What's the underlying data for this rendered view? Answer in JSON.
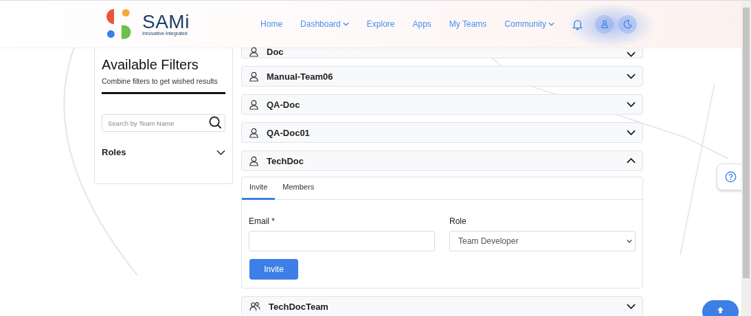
{
  "logo": {
    "name": "SAMi",
    "tagline": "Innovative-Integrated"
  },
  "nav": [
    {
      "label": "Home",
      "dropdown": false
    },
    {
      "label": "Dashboard",
      "dropdown": true
    },
    {
      "label": "Explore",
      "dropdown": false
    },
    {
      "label": "Apps",
      "dropdown": false
    },
    {
      "label": "My Teams",
      "dropdown": false
    },
    {
      "label": "Community",
      "dropdown": true
    }
  ],
  "filters": {
    "title": "Available Filters",
    "subtitle": "Combine filters to get wished results",
    "search": {
      "placeholder": "Search by Team Name"
    },
    "sections": [
      {
        "label": "Roles",
        "expanded": false
      }
    ]
  },
  "teams": [
    {
      "name": "Doc",
      "kind": "single",
      "expanded": false
    },
    {
      "name": "Manual-Team06",
      "kind": "single",
      "expanded": false
    },
    {
      "name": "QA-Doc",
      "kind": "single",
      "expanded": false
    },
    {
      "name": "QA-Doc01",
      "kind": "single",
      "expanded": false
    },
    {
      "name": "TechDoc",
      "kind": "single",
      "expanded": true
    },
    {
      "name": "TechDocTeam",
      "kind": "group",
      "expanded": false
    }
  ],
  "panel": {
    "tabs": [
      {
        "label": "Invite",
        "selected": true
      },
      {
        "label": "Members",
        "selected": false
      }
    ],
    "email": {
      "label": "Email *"
    },
    "role": {
      "label": "Role",
      "value": "Team Developer"
    },
    "submit": "Invite"
  }
}
